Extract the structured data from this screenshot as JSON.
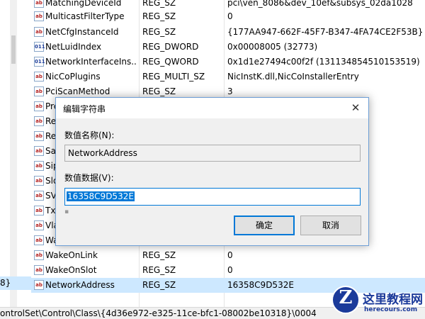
{
  "tree": {
    "selected_label": "8}"
  },
  "values": [
    {
      "icon": "string",
      "name": "MatchingDeviceId",
      "type": "REG_SZ",
      "data": "pci\\ven_8086&dev_10ef&subsys_02da1028"
    },
    {
      "icon": "string",
      "name": "MulticastFilterType",
      "type": "REG_SZ",
      "data": "0"
    },
    {
      "icon": "string",
      "name": "NetCfgInstanceId",
      "type": "REG_SZ",
      "data": "{177AA947-662F-45F7-B347-4FA74CE2F53B}"
    },
    {
      "icon": "binary",
      "name": "NetLuidIndex",
      "type": "REG_DWORD",
      "data": "0x00008005 (32773)"
    },
    {
      "icon": "binary",
      "name": "NetworkInterfaceIns...",
      "type": "REG_QWORD",
      "data": "0x1d1e27494c00f2f (131134854510153519)"
    },
    {
      "icon": "string",
      "name": "NicCoPlugins",
      "type": "REG_MULTI_SZ",
      "data": "NicInstK.dll,NicCoInstallerEntry"
    },
    {
      "icon": "string",
      "name": "PciScanMethod",
      "type": "REG_SZ",
      "data": "3"
    },
    {
      "icon": "string",
      "name": "Pre",
      "type": "",
      "data": ""
    },
    {
      "icon": "string",
      "name": "Re",
      "type": "",
      "data": ""
    },
    {
      "icon": "string",
      "name": "Re",
      "type": "",
      "data": ""
    },
    {
      "icon": "string",
      "name": "Sa",
      "type": "",
      "data": ""
    },
    {
      "icon": "string",
      "name": "Sip",
      "type": "",
      "data": ""
    },
    {
      "icon": "string",
      "name": "Slo",
      "type": "",
      "data": ""
    },
    {
      "icon": "string",
      "name": "SV",
      "type": "",
      "data": ""
    },
    {
      "icon": "string",
      "name": "Tx",
      "type": "",
      "data": ""
    },
    {
      "icon": "string",
      "name": "Vla",
      "type": "",
      "data": ""
    },
    {
      "icon": "string",
      "name": "Wa",
      "type": "",
      "data": ""
    },
    {
      "icon": "string",
      "name": "WakeOnLink",
      "type": "REG_SZ",
      "data": "0"
    },
    {
      "icon": "string",
      "name": "WakeOnSlot",
      "type": "REG_SZ",
      "data": "0"
    },
    {
      "icon": "string",
      "name": "NetworkAddress",
      "type": "REG_SZ",
      "data": "16358C9D532E",
      "selected": true
    }
  ],
  "icon_text": {
    "string": "ab",
    "binary": "011"
  },
  "status_bar": {
    "path": "ontrolSet\\Control\\Class\\{4d36e972-e325-11ce-bfc1-08002be10318}\\0004"
  },
  "dialog": {
    "title": "编辑字符串",
    "close_glyph": "✕",
    "name_label": "数值名称(N):",
    "name_value": "NetworkAddress",
    "data_label": "数值数据(V):",
    "data_value": "16358C9D532E",
    "ok_label": "确定",
    "cancel_label": "取消"
  },
  "watermark": {
    "cn": "这里教程网",
    "url": "herecours.com",
    "badge": "Z"
  },
  "colors": {
    "selection": "#cde8ff",
    "accent": "#0078d7",
    "watermark": "#1b3a9a"
  }
}
